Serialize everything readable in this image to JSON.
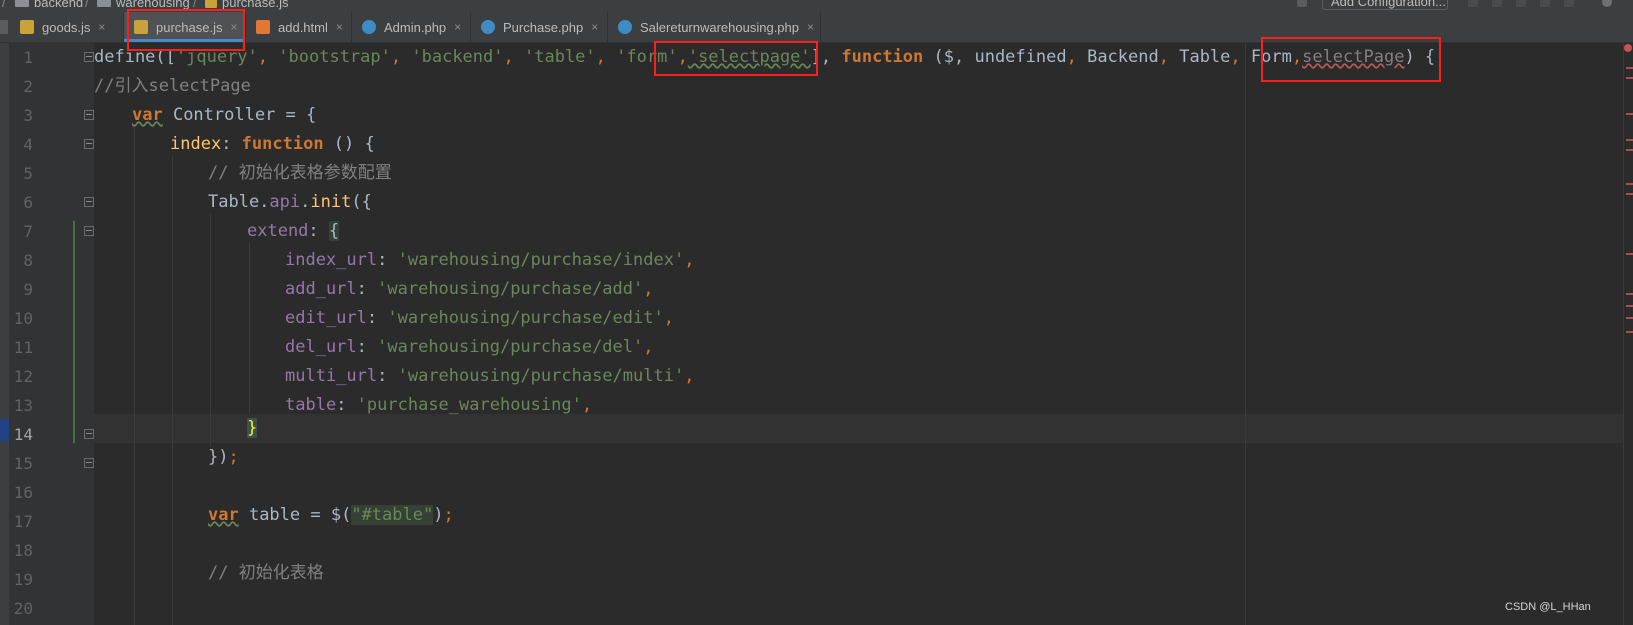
{
  "breadcrumb": {
    "items": [
      "backend",
      "warehousing",
      "purchase.js"
    ],
    "add_configuration": "Add Configuration..."
  },
  "tabs": [
    {
      "label": "goods.js",
      "icon": "js-file-icon",
      "active": false
    },
    {
      "label": "purchase.js",
      "icon": "js-file-icon",
      "active": true
    },
    {
      "label": "add.html",
      "icon": "html-file-icon",
      "active": false
    },
    {
      "label": "Admin.php",
      "icon": "php-class-icon",
      "active": false
    },
    {
      "label": "Purchase.php",
      "icon": "php-class-icon",
      "active": false
    },
    {
      "label": "Salereturnwarehousing.php",
      "icon": "php-class-icon",
      "active": false
    }
  ],
  "editor": {
    "current_line": 14,
    "line_numbers": [
      "1",
      "2",
      "3",
      "4",
      "5",
      "6",
      "7",
      "8",
      "9",
      "10",
      "11",
      "12",
      "13",
      "14",
      "15",
      "16",
      "17",
      "18",
      "19",
      "20"
    ],
    "lines": {
      "l1": {
        "define": "define([",
        "jquery": "'jquery'",
        "c1": ",",
        "bootstrap": "'bootstrap'",
        "c2": ",",
        "backend": "'backend'",
        "c3": ",",
        "table": "'table'",
        "c4": ",",
        "form": "'form'",
        "c5": ",",
        "selectpage": "'selectpage'",
        "close": "],",
        "function": "function",
        "params_open": " ($,",
        "undefined": " undefined",
        "c6": ",",
        "Backend": " Backend",
        "c7": ",",
        "Table": " Table",
        "c8": ",",
        "Form": " Form",
        "c9": ",",
        "selectPage": "selectPage",
        "end": ") {"
      },
      "l2": "//引入selectPage",
      "l3": {
        "var": "var",
        "rest": " Controller = {"
      },
      "l4": {
        "index": "index",
        "colon": ": ",
        "function": "function",
        "rest": " () {"
      },
      "l5": "// 初始化表格参数配置",
      "l6": {
        "pre": "Table.",
        "api": "api",
        "dot": ".",
        "init": "init",
        "rest": "({"
      },
      "l7": {
        "extend": "extend",
        "colon": ": ",
        "brace": "{"
      },
      "l8": {
        "key": "index_url",
        "colon": ": ",
        "val": "'warehousing/purchase/index'",
        "comma": ","
      },
      "l9": {
        "key": "add_url",
        "colon": ": ",
        "val": "'warehousing/purchase/add'",
        "comma": ","
      },
      "l10": {
        "key": "edit_url",
        "colon": ": ",
        "val": "'warehousing/purchase/edit'",
        "comma": ","
      },
      "l11": {
        "key": "del_url",
        "colon": ": ",
        "val": "'warehousing/purchase/del'",
        "comma": ","
      },
      "l12": {
        "key": "multi_url",
        "colon": ": ",
        "val": "'warehousing/purchase/multi'",
        "comma": ","
      },
      "l13": {
        "key": "table",
        "colon": ": ",
        "val": "'purchase_warehousing'",
        "comma": ","
      },
      "l14": "}",
      "l15": {
        "rest": "})",
        "semi": ";"
      },
      "l17": {
        "var": "var",
        "mid": " table = $(",
        "str": "\"#table\"",
        "end": ")",
        "semi": ";"
      },
      "l19": "// 初始化表格"
    }
  },
  "watermark": "CSDN @L_HHan",
  "colors": {
    "annotation_box": "#ff1e1e",
    "active_tab_underline": "#4a88c7",
    "editor_bg": "#2b2b2b"
  }
}
